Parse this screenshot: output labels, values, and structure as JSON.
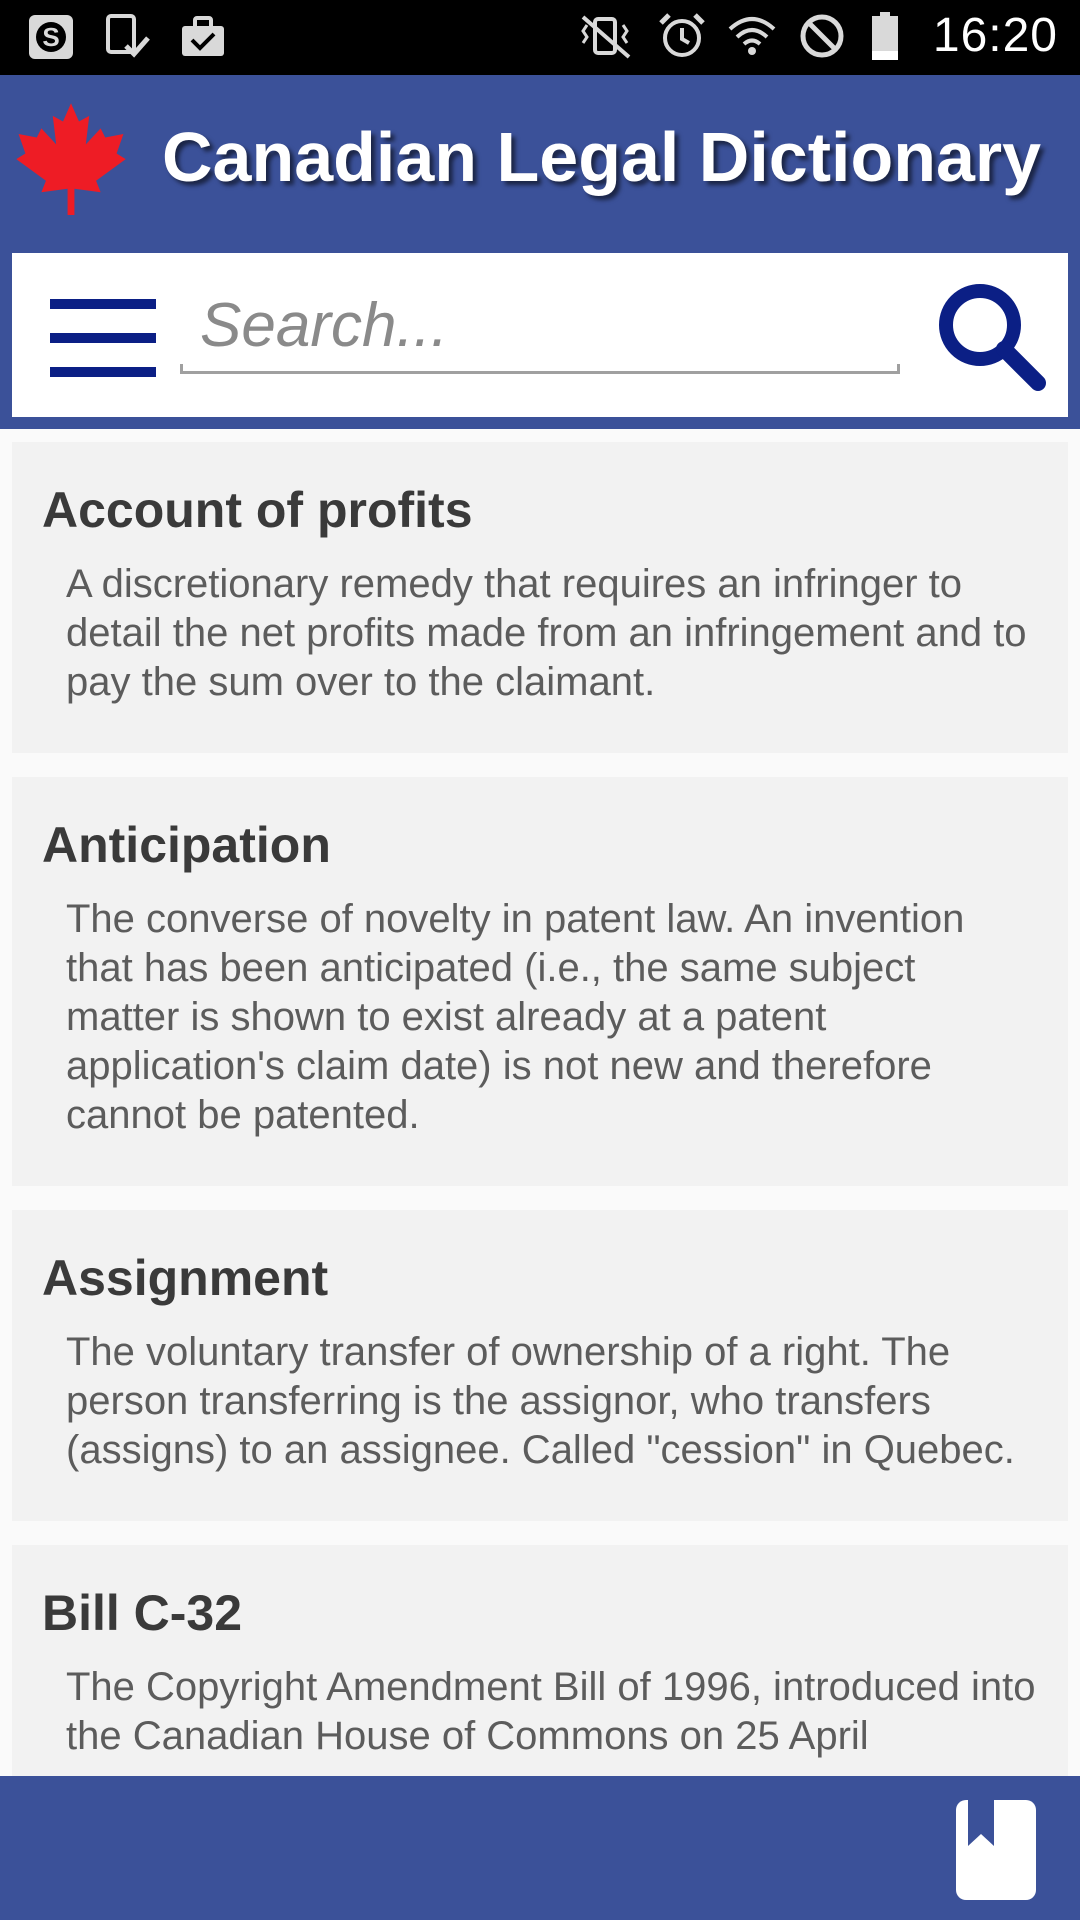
{
  "status_bar": {
    "time": "16:20",
    "left_icons": [
      "skype-icon",
      "download-done-icon",
      "briefcase-check-icon"
    ],
    "right_icons": [
      "vibrate-mute-icon",
      "alarm-icon",
      "wifi-icon",
      "blocked-icon",
      "battery-icon"
    ]
  },
  "app_bar": {
    "title": "Canadian Legal Dictionary",
    "logo_icon": "maple-leaf-icon",
    "accent_color": "#3b5199",
    "logo_color": "#ee1c25"
  },
  "search": {
    "placeholder": "Search...",
    "value": "",
    "menu_icon": "hamburger-menu-icon",
    "search_icon": "magnifier-icon",
    "icon_color": "#0b1f85"
  },
  "entries": [
    {
      "term": "Account of profits",
      "definition": "A discretionary remedy that requires an infringer to detail the net profits made from an infringement and to pay the sum over to the claimant."
    },
    {
      "term": "Anticipation",
      "definition": "The converse of novelty in patent law. An invention that has been anticipated (i.e., the same subject matter is shown to exist already at a patent application's claim date) is not new and therefore cannot be patented."
    },
    {
      "term": "Assignment",
      "definition": "The voluntary transfer of ownership of a right. The person transferring is the assignor, who transfers (assigns) to an assignee. Called \"cession\" in Quebec."
    },
    {
      "term": "Bill C-32",
      "definition": "The Copyright Amendment Bill of 1996, introduced into the Canadian House of Commons on 25 April"
    }
  ],
  "bottom_bar": {
    "bookmark_icon": "bookmark-icon"
  }
}
